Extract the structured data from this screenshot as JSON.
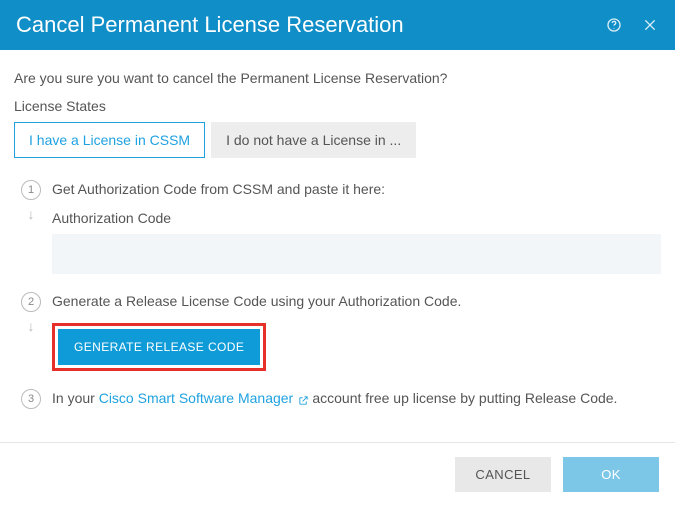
{
  "header": {
    "title": "Cancel Permanent License Reservation"
  },
  "prompt": "Are you sure you want to cancel the Permanent License Reservation?",
  "license_states_label": "License States",
  "tabs": {
    "active": "I have a License in CSSM",
    "inactive": "I do not have a License in ..."
  },
  "steps": {
    "s1": {
      "num": "1",
      "text": "Get Authorization Code from CSSM and paste it here:",
      "sub_label": "Authorization Code",
      "code_value": " "
    },
    "s2": {
      "num": "2",
      "text": "Generate a Release License Code using your Authorization Code.",
      "button": "GENERATE RELEASE CODE"
    },
    "s3": {
      "num": "3",
      "pre": "In your ",
      "link": "Cisco Smart Software Manager",
      "post": " account free up license by putting Release Code."
    }
  },
  "footer": {
    "cancel": "CANCEL",
    "ok": "OK"
  }
}
